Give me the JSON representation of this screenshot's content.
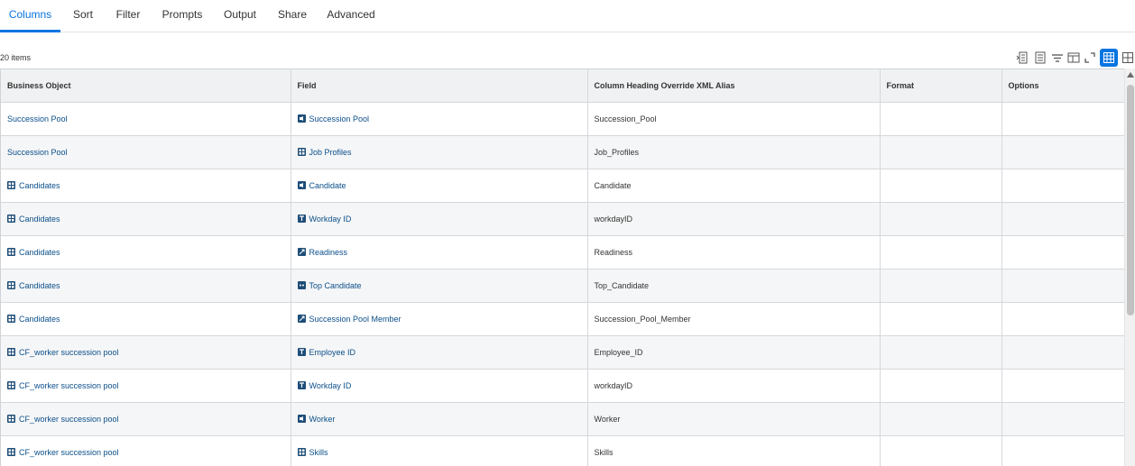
{
  "tabs": [
    {
      "label": "Columns",
      "active": true
    },
    {
      "label": "Sort"
    },
    {
      "label": "Filter"
    },
    {
      "label": "Prompts"
    },
    {
      "label": "Output"
    },
    {
      "label": "Share"
    },
    {
      "label": "Advanced"
    }
  ],
  "grid": {
    "count_label": "20 items",
    "headers": [
      "Business Object",
      "Field",
      "Column Heading Override XML Alias",
      "Format",
      "Options"
    ],
    "rows": [
      {
        "bo": "Succession Pool",
        "bo_icon": "",
        "field": "Succession Pool",
        "field_icon": "single-instance-icon",
        "alias": "Succession_Pool",
        "format": "",
        "options": ""
      },
      {
        "bo": "Succession Pool",
        "bo_icon": "",
        "field": "Job Profiles",
        "field_icon": "multi-instance-icon",
        "alias": "Job_Profiles",
        "format": "",
        "options": ""
      },
      {
        "bo": "Candidates",
        "bo_icon": "multi-instance-icon",
        "field": "Candidate",
        "field_icon": "single-instance-icon",
        "alias": "Candidate",
        "format": "",
        "options": ""
      },
      {
        "bo": "Candidates",
        "bo_icon": "multi-instance-icon",
        "field": "Workday ID",
        "field_icon": "text-icon",
        "alias": "workdayID",
        "format": "",
        "options": ""
      },
      {
        "bo": "Candidates",
        "bo_icon": "multi-instance-icon",
        "field": "Readiness",
        "field_icon": "expand-icon",
        "alias": "Readiness",
        "format": "",
        "options": ""
      },
      {
        "bo": "Candidates",
        "bo_icon": "multi-instance-icon",
        "field": "Top Candidate",
        "field_icon": "boolean-icon",
        "alias": "Top_Candidate",
        "format": "",
        "options": ""
      },
      {
        "bo": "Candidates",
        "bo_icon": "multi-instance-icon",
        "field": "Succession Pool Member",
        "field_icon": "expand-icon",
        "alias": "Succession_Pool_Member",
        "format": "",
        "options": ""
      },
      {
        "bo": "CF_worker succession pool",
        "bo_icon": "multi-instance-icon",
        "field": "Employee ID",
        "field_icon": "text-icon",
        "alias": "Employee_ID",
        "format": "",
        "options": ""
      },
      {
        "bo": "CF_worker succession pool",
        "bo_icon": "multi-instance-icon",
        "field": "Workday ID",
        "field_icon": "text-icon",
        "alias": "workdayID",
        "format": "",
        "options": ""
      },
      {
        "bo": "CF_worker succession pool",
        "bo_icon": "multi-instance-icon",
        "field": "Worker",
        "field_icon": "single-instance-icon",
        "alias": "Worker",
        "format": "",
        "options": ""
      },
      {
        "bo": "CF_worker succession pool",
        "bo_icon": "multi-instance-icon",
        "field": "Skills",
        "field_icon": "multi-instance-icon",
        "alias": "Skills",
        "format": "",
        "options": ""
      }
    ]
  },
  "toolbar": {
    "icons": [
      "export-to-excel-icon",
      "export-to-pdf-icon",
      "filter-icon",
      "column-chooser-icon",
      "fullscreen-icon",
      "table-view-icon",
      "grid-view-icon"
    ],
    "active_icon": "table-view-icon"
  },
  "colors": {
    "accent": "#0875e1",
    "link": "#0b4f8a",
    "icon_fill": "#1f4e79",
    "header_bg": "#f0f1f2"
  }
}
